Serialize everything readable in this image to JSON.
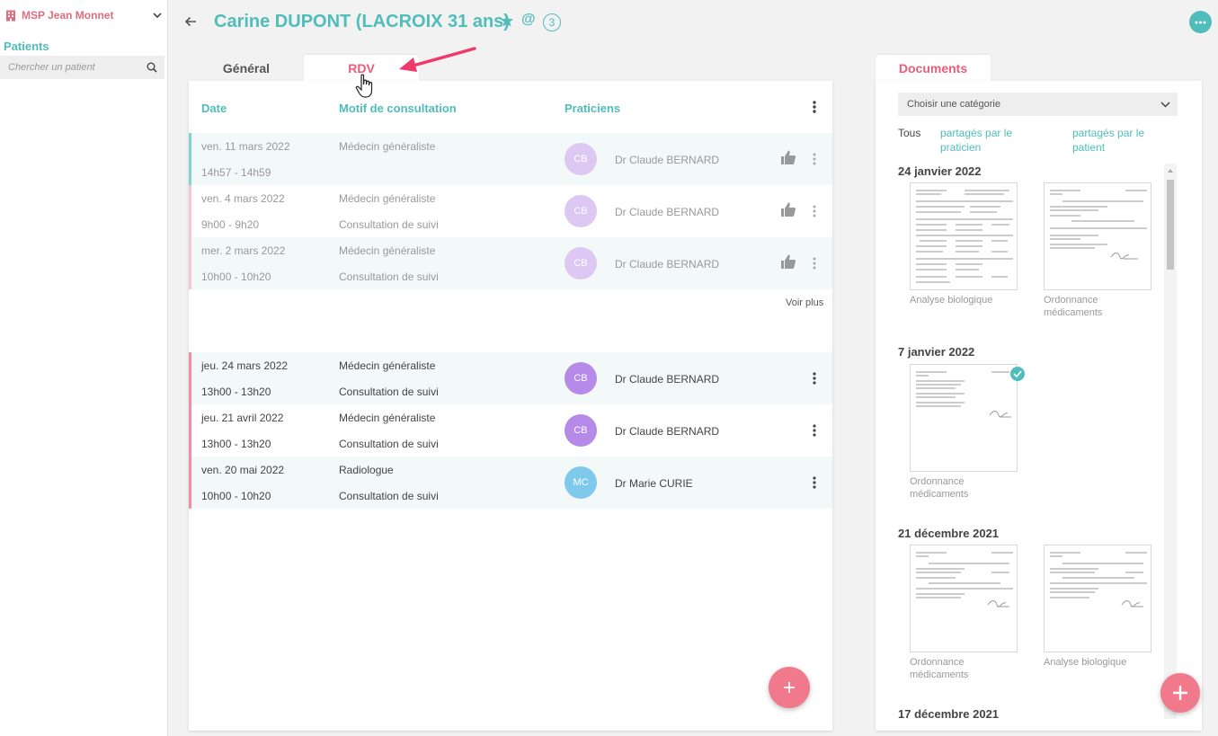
{
  "sidebar": {
    "org_name": "MSP Jean Monnet",
    "patients_label": "Patients",
    "search_placeholder": "Chercher un patient"
  },
  "header": {
    "title": "Carine DUPONT (LACROIX 31 ans)",
    "at_symbol": "@",
    "badge_count": "3"
  },
  "tabs": {
    "general": "Général",
    "rdv": "RDV",
    "documents": "Documents"
  },
  "rdv": {
    "columns": {
      "date": "Date",
      "motif": "Motif de consultation",
      "praticiens": "Praticiens"
    },
    "past": [
      {
        "date": "ven. 11 mars 2022",
        "time": "14h57 - 14h59",
        "motif": "Médecin généraliste",
        "sub": "",
        "initials": "CB",
        "doctor": "Dr Claude BERNARD"
      },
      {
        "date": "ven. 4 mars 2022",
        "time": "9h00 - 9h20",
        "motif": "Médecin généraliste",
        "sub": "Consultation de suivi",
        "initials": "CB",
        "doctor": "Dr Claude BERNARD"
      },
      {
        "date": "mer. 2 mars 2022",
        "time": "10h00 - 10h20",
        "motif": "Médecin généraliste",
        "sub": "Consultation de suivi",
        "initials": "CB",
        "doctor": "Dr Claude BERNARD"
      }
    ],
    "voir_plus": "Voir plus",
    "upcoming": [
      {
        "date": "jeu. 24 mars 2022",
        "time": "13h00 - 13h20",
        "motif": "Médecin généraliste",
        "sub": "Consultation de suivi",
        "initials": "CB",
        "doctor": "Dr Claude BERNARD"
      },
      {
        "date": "jeu. 21 avril 2022",
        "time": "13h00 - 13h20",
        "motif": "Médecin généraliste",
        "sub": "Consultation de suivi",
        "initials": "CB",
        "doctor": "Dr Claude BERNARD"
      },
      {
        "date": "ven. 20 mai 2022",
        "time": "10h00 - 10h20",
        "motif": "Radiologue",
        "sub": "Consultation de suivi",
        "initials": "MC",
        "doctor": "Dr Marie CURIE"
      }
    ]
  },
  "documents": {
    "category_placeholder": "Choisir une catégorie",
    "filters": {
      "all": "Tous",
      "by_practitioner": "partagés par le praticien",
      "by_patient": "partagés par le patient"
    },
    "groups": [
      {
        "date": "24 janvier 2022",
        "docs": [
          "Analyse biologique",
          "Ordonnance médicaments"
        ]
      },
      {
        "date": "7 janvier 2022",
        "docs": [
          "Ordonnance médicaments"
        ]
      },
      {
        "date": "21 décembre 2021",
        "docs": [
          "Ordonnance médicaments",
          "Analyse biologique"
        ]
      },
      {
        "date": "17 décembre 2021",
        "docs": []
      }
    ]
  },
  "colors": {
    "teal": "#4fbdba",
    "pink": "#e85d7a",
    "fab": "#f07a8c",
    "past_bar_teal": "#7fd6cf",
    "past_bar_pink": "#f6c9d2",
    "future_bar": "#ef8fa6"
  },
  "icons": [
    "building-icon",
    "chevron-down-icon",
    "search-icon",
    "back-arrow-icon",
    "star-icon",
    "more-horizontal-icon",
    "kebab-icon",
    "thumb-up-icon",
    "plus-icon",
    "check-icon",
    "hand-cursor-icon"
  ]
}
